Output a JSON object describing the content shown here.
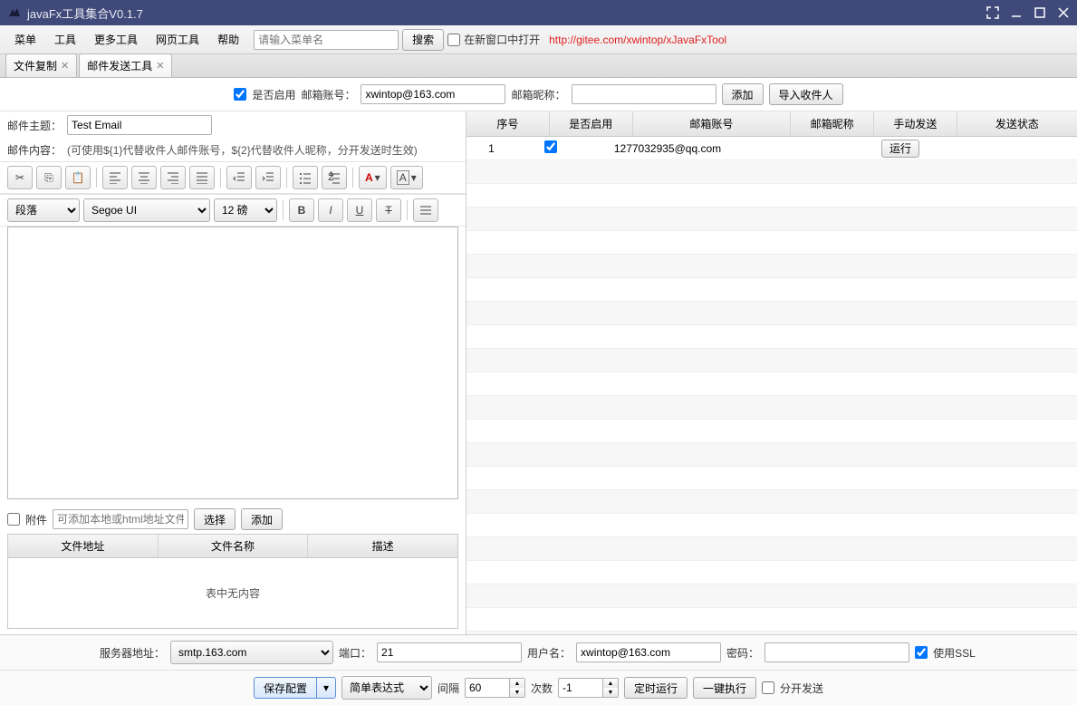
{
  "window": {
    "title": "javaFx工具集合V0.1.7"
  },
  "menu": {
    "items": [
      "菜单",
      "工具",
      "更多工具",
      "网页工具",
      "帮助"
    ],
    "search_placeholder": "请输入菜单名",
    "search_btn": "搜索",
    "newwindow_label": "在新窗口中打开",
    "link": "http://gitee.com/xwintop/xJavaFxTool"
  },
  "tabs": [
    {
      "label": "文件复制",
      "active": false
    },
    {
      "label": "邮件发送工具",
      "active": true
    }
  ],
  "top": {
    "enable_label": "是否启用",
    "account_label": "邮箱账号：",
    "account_value": "xwintop@163.com",
    "nick_label": "邮箱昵称：",
    "nick_value": "",
    "add_btn": "添加",
    "import_btn": "导入收件人"
  },
  "left": {
    "subject_label": "邮件主题：",
    "subject_value": "Test Email",
    "content_label": "邮件内容：",
    "content_hint": "(可使用${1}代替收件人邮件账号，${2}代替收件人昵称，分开发送时生效)",
    "format_para": "段落",
    "format_font": "Segoe UI",
    "format_size": "12 磅",
    "attach_label": "附件",
    "attach_placeholder": "可添加本地或html地址文件",
    "choose_btn": "选择",
    "add_btn": "添加",
    "attach_cols": [
      "文件地址",
      "文件名称",
      "描述"
    ],
    "attach_empty": "表中无内容"
  },
  "table": {
    "cols": [
      "序号",
      "是否启用",
      "邮箱账号",
      "邮箱昵称",
      "手动发送",
      "发送状态"
    ],
    "rows": [
      {
        "seq": "1",
        "enabled": true,
        "account": "1277032935@qq.com",
        "nick": "",
        "manual_btn": "运行",
        "status": ""
      }
    ]
  },
  "server": {
    "addr_label": "服务器地址：",
    "addr_value": "smtp.163.com",
    "port_label": "端口：",
    "port_value": "21",
    "user_label": "用户名：",
    "user_value": "xwintop@163.com",
    "pass_label": "密码：",
    "pass_value": "",
    "ssl_label": "使用SSL"
  },
  "bottom": {
    "save_btn": "保存配置",
    "expr_btn": "简单表达式",
    "interval_label": "间隔",
    "interval_value": "60",
    "count_label": "次数",
    "count_value": "-1",
    "timed_btn": "定时运行",
    "exec_btn": "一键执行",
    "split_label": "分开发送"
  }
}
